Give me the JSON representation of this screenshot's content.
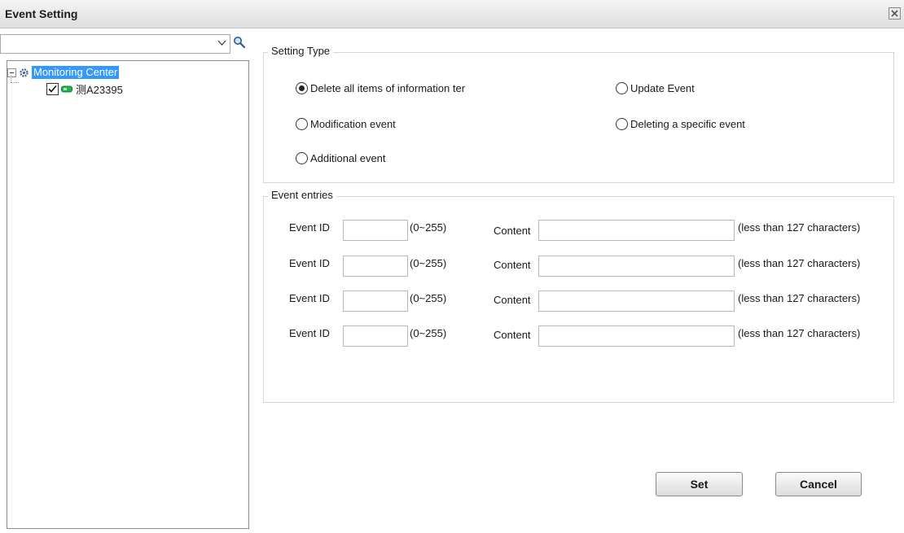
{
  "window": {
    "title": "Event Setting"
  },
  "tree": {
    "search": {
      "value": "",
      "placeholder": ""
    },
    "root": {
      "label": "Monitoring Center"
    },
    "child": {
      "label": "测A23395",
      "checked": true
    }
  },
  "setting_type": {
    "legend": "Setting Type",
    "options": [
      {
        "label": "Delete all items of information ter",
        "checked": true
      },
      {
        "label": "Update Event",
        "checked": false
      },
      {
        "label": "Modification event",
        "checked": false
      },
      {
        "label": "Deleting a specific event",
        "checked": false
      },
      {
        "label": "Additional event",
        "checked": false
      }
    ]
  },
  "event_entries": {
    "legend": "Event entries",
    "rows": [
      {
        "id_label": "Event ID",
        "range": "(0~255)",
        "content_label": "Content",
        "hint": "(less than 127 characters)",
        "id_value": "",
        "content_value": ""
      },
      {
        "id_label": "Event ID",
        "range": "(0~255)",
        "content_label": "Content",
        "hint": "(less than 127 characters)",
        "id_value": "",
        "content_value": ""
      },
      {
        "id_label": "Event ID",
        "range": "(0~255)",
        "content_label": "Content",
        "hint": "(less than 127 characters)",
        "id_value": "",
        "content_value": ""
      },
      {
        "id_label": "Event ID",
        "range": "(0~255)",
        "content_label": "Content",
        "hint": "(less than 127 characters)",
        "id_value": "",
        "content_value": ""
      }
    ]
  },
  "buttons": {
    "set": "Set",
    "cancel": "Cancel"
  },
  "icons": {
    "close": "close-icon",
    "search": "search-icon",
    "dropdown": "chevron-down-icon",
    "gear": "gear-icon",
    "vehicle": "vehicle-icon",
    "check": "checkmark-icon"
  },
  "colors": {
    "selection": "#3399ff",
    "titlebar": "#e6e6e6",
    "vehicle": "#22b14c"
  }
}
